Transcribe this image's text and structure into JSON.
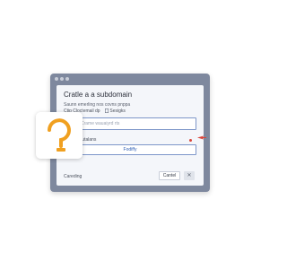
{
  "dialog": {
    "title": "Cratle a a subdomain",
    "subtitle": "Saunn emerling nos covns pnppa",
    "meta_prefix": "Ctip",
    "meta_label": "Cloctemail dp",
    "meta_doc": "Sesigks",
    "input_placeholder": "Crame wauaiyrd rts",
    "field_label": "Laloy ofdutalans",
    "modify_label": "Fodiffy",
    "footer_left": "Careding",
    "cancel_label": "Cantel",
    "close_symbol": "✕"
  },
  "colors": {
    "window_frame": "#7e889e",
    "accent": "#2f5fb5",
    "icon_orange": "#f0a020",
    "error_red": "#d9443a"
  },
  "icons": [
    "app-icon",
    "document-icon",
    "close-icon",
    "cursor-arrow-icon"
  ]
}
